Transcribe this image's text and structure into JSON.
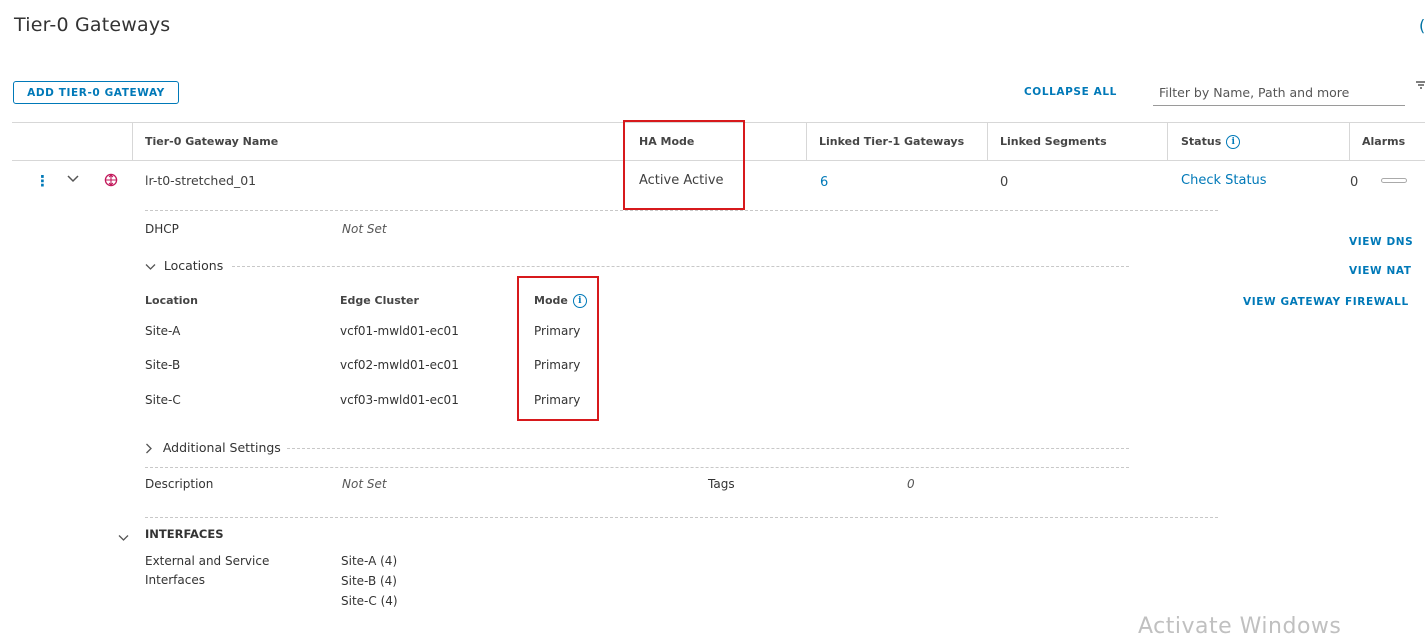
{
  "page": {
    "title": "Tier-0 Gateways",
    "help_glyph": "("
  },
  "toolbar": {
    "add_label": "ADD TIER-0 GATEWAY",
    "collapse_label": "COLLAPSE ALL",
    "filter_placeholder": "Filter by Name, Path and more",
    "filter_icon": "filter-icon"
  },
  "table": {
    "headers": {
      "name": "Tier-0 Gateway Name",
      "ha_mode": "HA Mode",
      "linked_t1": "Linked Tier-1 Gateways",
      "linked_segments": "Linked Segments",
      "status": "Status",
      "alarms": "Alarms"
    },
    "row": {
      "name": "lr-t0-stretched_01",
      "ha_mode": "Active Active",
      "linked_t1": "6",
      "linked_segments": "0",
      "status": "Check Status",
      "alarms": "0"
    }
  },
  "details": {
    "dhcp_label": "DHCP",
    "dhcp_value": "Not Set",
    "locations_label": "Locations",
    "locations_headers": {
      "location": "Location",
      "edge_cluster": "Edge Cluster",
      "mode": "Mode"
    },
    "locations": [
      {
        "location": "Site-A",
        "edge_cluster": "vcf01-mwld01-ec01",
        "mode": "Primary"
      },
      {
        "location": "Site-B",
        "edge_cluster": "vcf02-mwld01-ec01",
        "mode": "Primary"
      },
      {
        "location": "Site-C",
        "edge_cluster": "vcf03-mwld01-ec01",
        "mode": "Primary"
      }
    ],
    "additional_settings_label": "Additional Settings",
    "description_label": "Description",
    "description_value": "Not Set",
    "tags_label": "Tags",
    "tags_value": "0",
    "interfaces_label": "INTERFACES",
    "ext_service_label_1": "External and Service",
    "ext_service_label_2": "Interfaces",
    "interfaces": [
      "Site-A (4)",
      "Site-B (4)",
      "Site-C (4)"
    ]
  },
  "side_links": {
    "view_dns": "VIEW DNS",
    "view_nat": "VIEW NAT",
    "view_firewall": "VIEW GATEWAY FIREWALL"
  },
  "watermark": "Activate Windows",
  "colors": {
    "accent": "#0079b8",
    "highlight_box": "#d7191c"
  }
}
